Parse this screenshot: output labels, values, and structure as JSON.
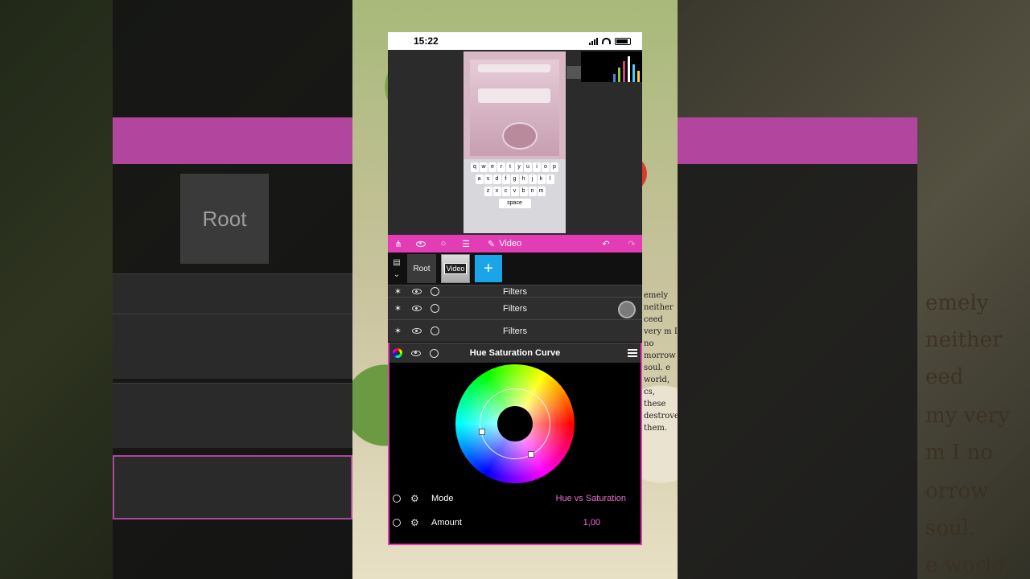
{
  "status_bar": {
    "time": "15:22"
  },
  "toolbar": {
    "mode_label": "Video"
  },
  "layers": {
    "root_label": "Root",
    "video_label": "Video",
    "add_symbol": "+"
  },
  "filters": [
    {
      "label": "Filters"
    },
    {
      "label": "Filters"
    },
    {
      "label": "Filters"
    }
  ],
  "effect_panel": {
    "title": "Hue Saturation Curve",
    "params": [
      {
        "name": "Mode",
        "value": "Hue vs Saturation"
      },
      {
        "name": "Amount",
        "value": "1,00"
      }
    ]
  },
  "background": {
    "ghost_root_label": "Root",
    "book_text": "emely neither ceed very m I no morrow soul. e world, cs, these destrove them.",
    "ghost_words": [
      "emely",
      "neither",
      "eed",
      "my very",
      "m I no",
      "orrow",
      "soul.",
      "e world,"
    ]
  },
  "colors": {
    "accent": "#e23db4",
    "add_button": "#1aa5e8",
    "value_text": "#e86fd2"
  },
  "icons": [
    "hierarchy-icon",
    "eye-icon",
    "circle-icon",
    "menu-icon",
    "pencil-icon",
    "undo-icon",
    "redo-icon",
    "layers-list-icon",
    "chevron-down-icon",
    "magic-wand-icon",
    "target-icon",
    "color-wheel-icon",
    "timer-icon",
    "gear-icon"
  ]
}
